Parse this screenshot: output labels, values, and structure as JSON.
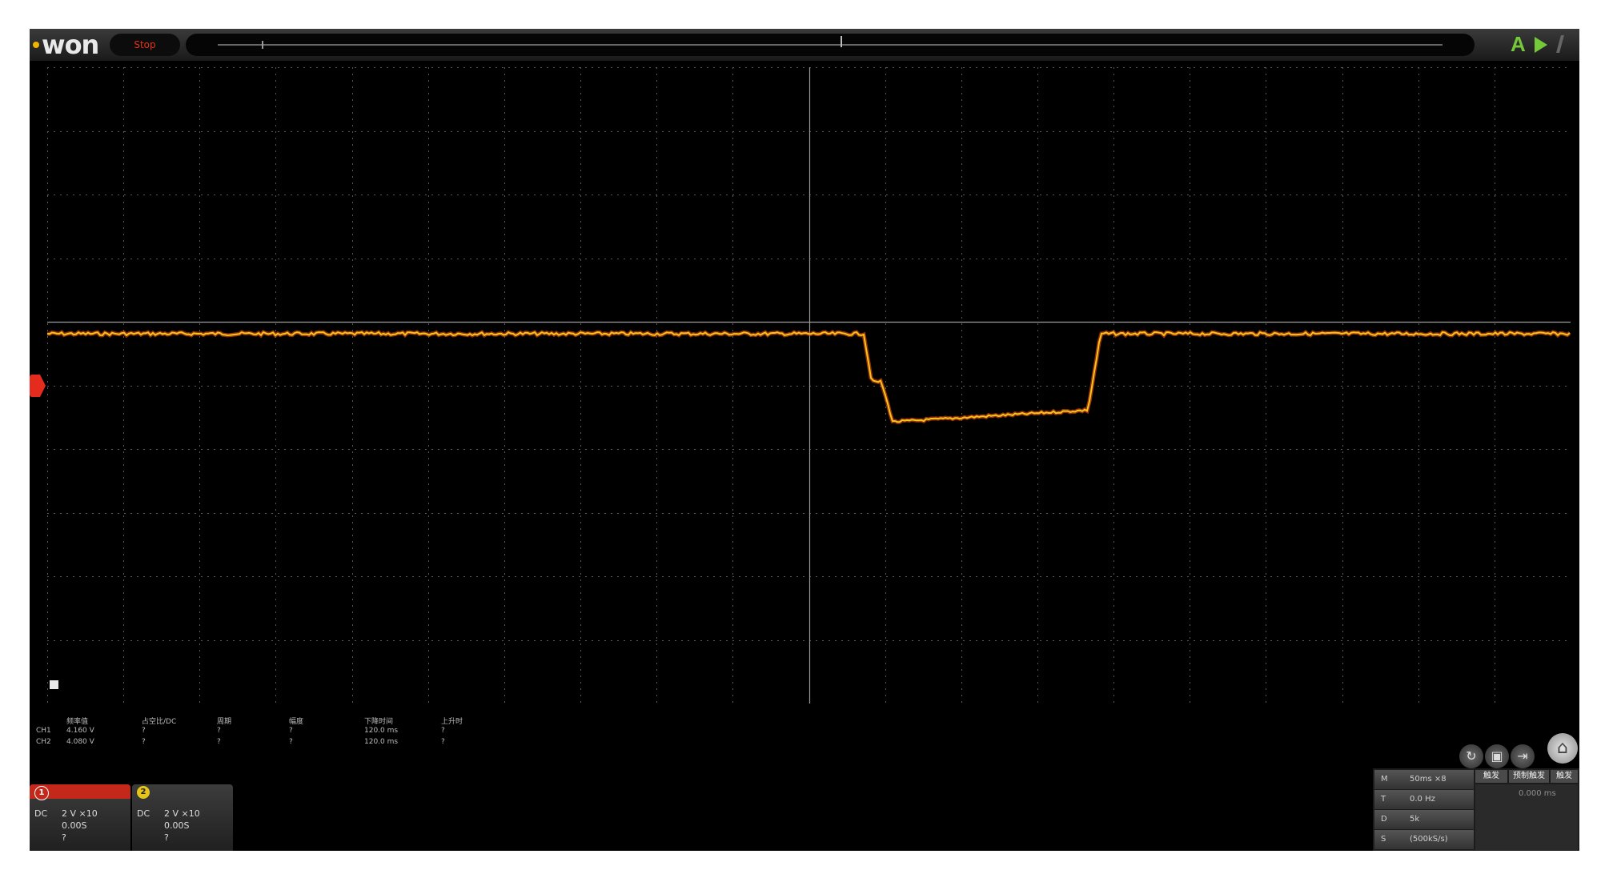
{
  "topbar": {
    "logo": "won",
    "run_state": "Stop",
    "trigger_mode": "A",
    "icons": [
      "run-arrow-icon",
      "slash-icon"
    ]
  },
  "waveform": {
    "channel": "CH1",
    "color": "#f5c518",
    "edge_color": "#e24a17",
    "marker_color": "#e52b1e"
  },
  "measure": {
    "headers": [
      "频率值",
      "占空比/DC",
      "周期",
      "幅度",
      "下降时间",
      "上升时"
    ],
    "rows": [
      {
        "label": "CH1",
        "values": [
          "4.160 V",
          "?",
          "?",
          "?",
          "120.0 ms",
          "?"
        ]
      },
      {
        "label": "CH2",
        "values": [
          "4.080 V",
          "?",
          "?",
          "?",
          "120.0 ms",
          "?"
        ]
      }
    ]
  },
  "tools": {
    "icons": [
      "refresh-icon",
      "save-icon",
      "export-icon",
      "home-icon"
    ]
  },
  "channels": [
    {
      "num": "1",
      "coupling": "DC",
      "scale": "2 V ×10",
      "offset": "0.00S",
      "extra": "?",
      "color": "#d82a1c"
    },
    {
      "num": "2",
      "coupling": "DC",
      "scale": "2 V ×10",
      "offset": "0.00S",
      "extra": "?",
      "color": "#e6c51a"
    }
  ],
  "timebase": {
    "rows": [
      {
        "k": "M",
        "v": "50ms ×8"
      },
      {
        "k": "T",
        "v": "0.0 Hz"
      },
      {
        "k": "D",
        "v": "5k"
      },
      {
        "k": "S",
        "v": "(500kS/s)"
      }
    ],
    "tabs": [
      "触发",
      "预制触发",
      "触发"
    ],
    "right_text": "0.000 ms"
  }
}
